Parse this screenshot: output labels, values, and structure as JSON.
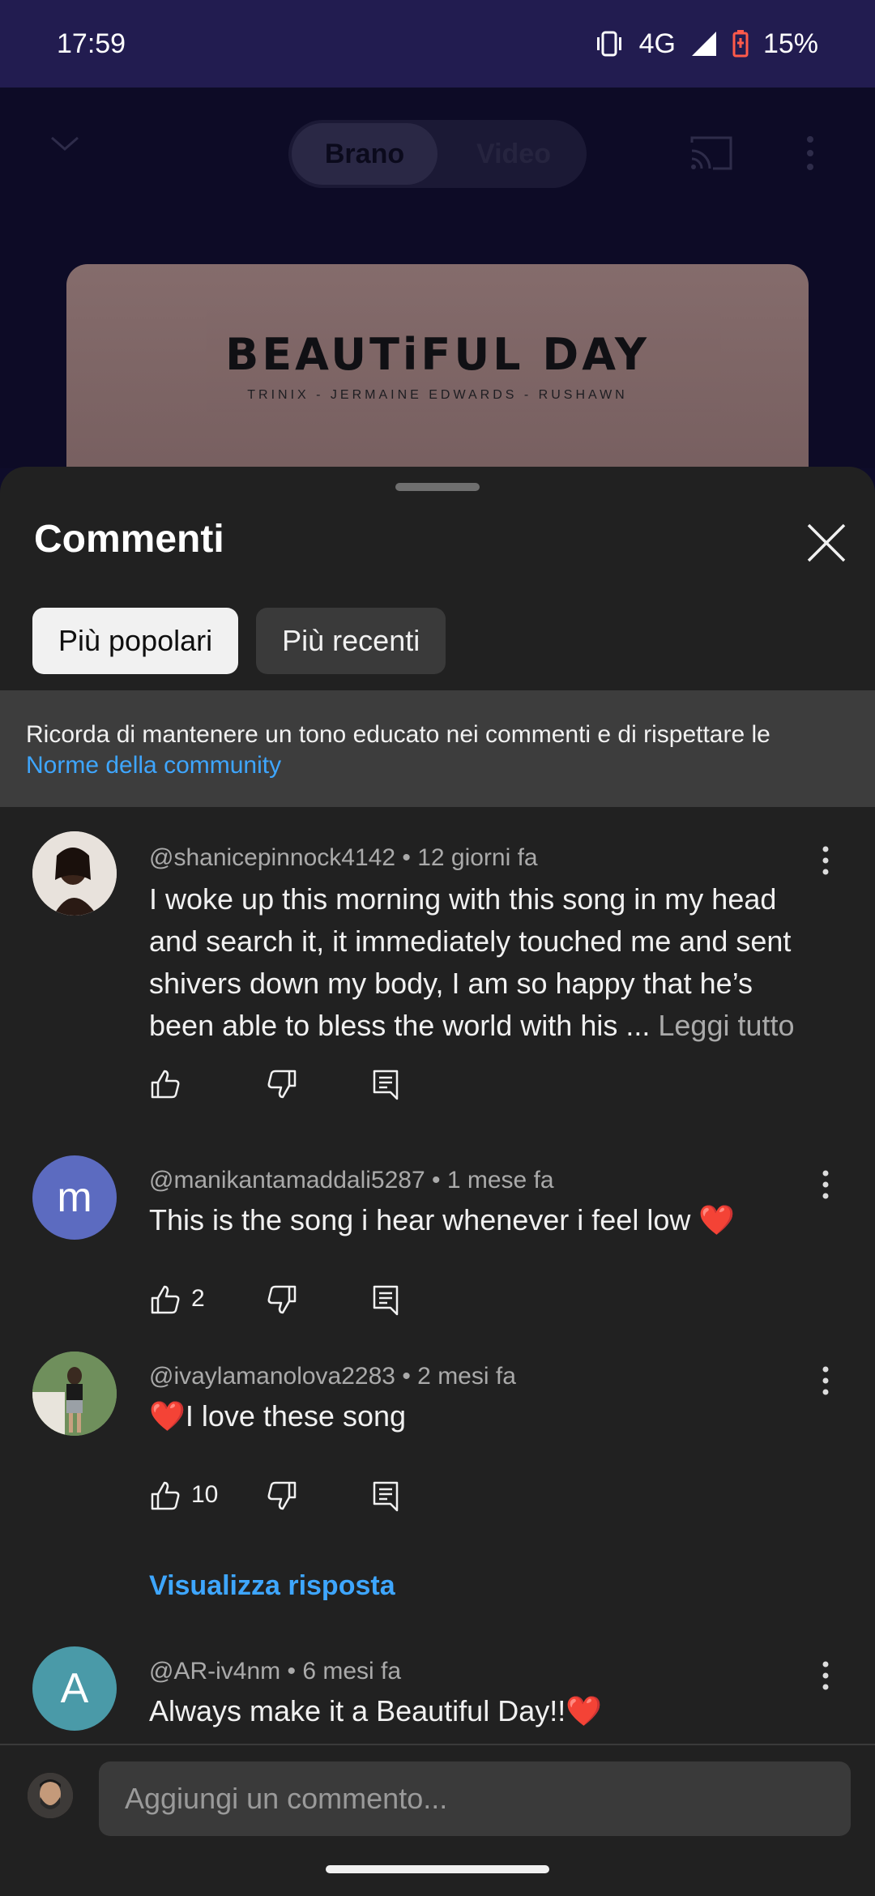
{
  "status_bar": {
    "time": "17:59",
    "network": "4G",
    "battery": "15%",
    "icons": [
      "vibrate-icon",
      "signal-icon",
      "battery-low-icon"
    ]
  },
  "player": {
    "tabs": [
      "Brano",
      "Video"
    ],
    "active_tab": "Brano",
    "artwork_title": "BEAUTiFUL DAY",
    "artwork_subtitle": "TRINIX - JERMAINE EDWARDS - RUSHAWN"
  },
  "comments_sheet": {
    "title": "Commenti",
    "chips": [
      "Più popolari",
      "Più recenti"
    ],
    "selected_chip": "Più popolari",
    "notice_text": "Ricorda di mantenere un tono educato nei commenti e di rispettare le",
    "notice_link": "Norme della community"
  },
  "comments": [
    {
      "author": "@shanicepinnock4142",
      "age": "12 giorni fa",
      "text": "I woke up this morning with this song in my head and search it, it immediately touched me and sent shivers down my body, I am so happy that he’s been able to bless the world with his ...",
      "read_more": "Leggi tutto",
      "likes": "",
      "avatar_letter": ""
    },
    {
      "author": "@manikantamaddali5287",
      "age": "1 mese fa",
      "text": "This is the song i hear whenever i feel low ❤️",
      "likes": "2",
      "avatar_letter": "m"
    },
    {
      "author": "@ivaylamanolova2283",
      "age": "2 mesi fa",
      "text": "❤️I love these song",
      "likes": "10",
      "avatar_letter": "",
      "view_replies": "Visualizza risposta"
    },
    {
      "author": "@AR-iv4nm",
      "age": "6 mesi fa",
      "text": "Always make it a Beautiful Day!!❤️",
      "likes": "",
      "avatar_letter": "A"
    }
  ],
  "composer": {
    "placeholder": "Aggiungi un commento..."
  },
  "colors": {
    "accent_link": "#3ea6ff",
    "sheet_bg": "#212121",
    "status_bar_bg": "#221c50"
  }
}
